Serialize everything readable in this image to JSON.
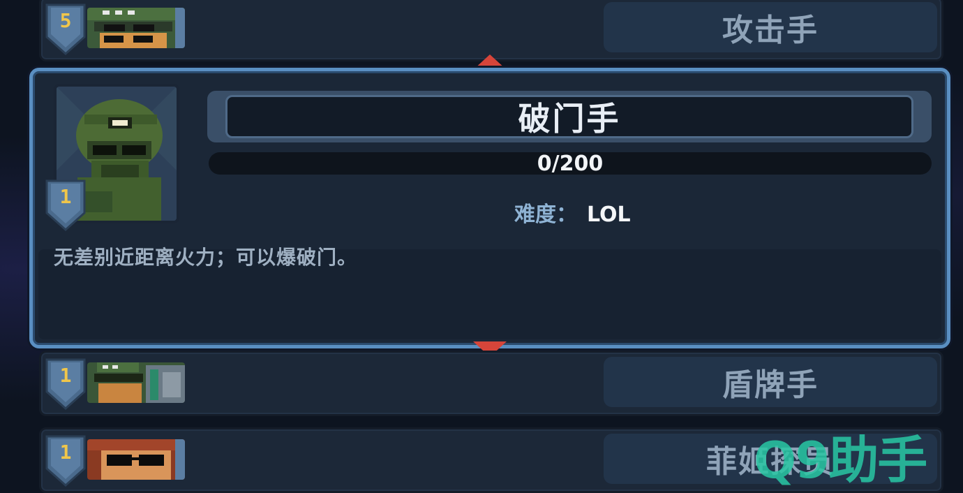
{
  "rows": [
    {
      "level": "5",
      "name": "攻击手"
    },
    {
      "level": "1",
      "name": "盾牌手"
    },
    {
      "level": "1",
      "name": "菲姬探员"
    }
  ],
  "selected": {
    "level": "1",
    "name": "破门手",
    "progress_text": "0/200",
    "progress_value": 0,
    "difficulty_label": "难度：",
    "difficulty_value": "LOL",
    "description": "无差别近距离火力；可以爆破门。"
  },
  "watermark": "Q9助手",
  "colors": {
    "card_border": "#5a8fc2",
    "arrow": "#d6453a",
    "level_text": "#f0c64a",
    "watermark": "#29c7a4"
  },
  "icons": [
    "level-shield-icon",
    "scroll-up-arrow-icon",
    "scroll-down-arrow-icon"
  ]
}
